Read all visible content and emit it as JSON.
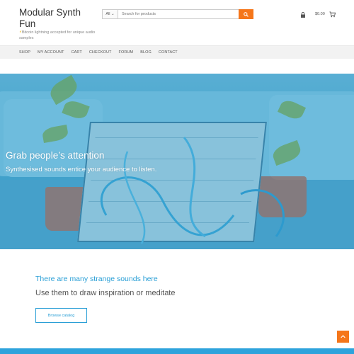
{
  "header": {
    "site_title": "Modular Synth Fun",
    "tagline": "Bitcoin lightning accepted for unique audio samples",
    "tagline_icon": "lightning-bolt-icon",
    "search": {
      "category": "All",
      "placeholder": "Search for products"
    },
    "cart_total": "$0.00",
    "accent_color": "#f5761a"
  },
  "nav": {
    "items": [
      "SHOP",
      "MY ACCOUNT",
      "CART",
      "CHECKOUT",
      "FORUM",
      "BLOG",
      "CONTACT"
    ]
  },
  "hero": {
    "title": "Grab people’s attention",
    "subtitle": "Synthesised sounds entice your audience to listen."
  },
  "promo": {
    "title": "There are many strange sounds here",
    "subtitle": "Use them to draw inspiration or meditate",
    "button_label": "Browse catalog",
    "accent_color": "#2a9fd6"
  }
}
